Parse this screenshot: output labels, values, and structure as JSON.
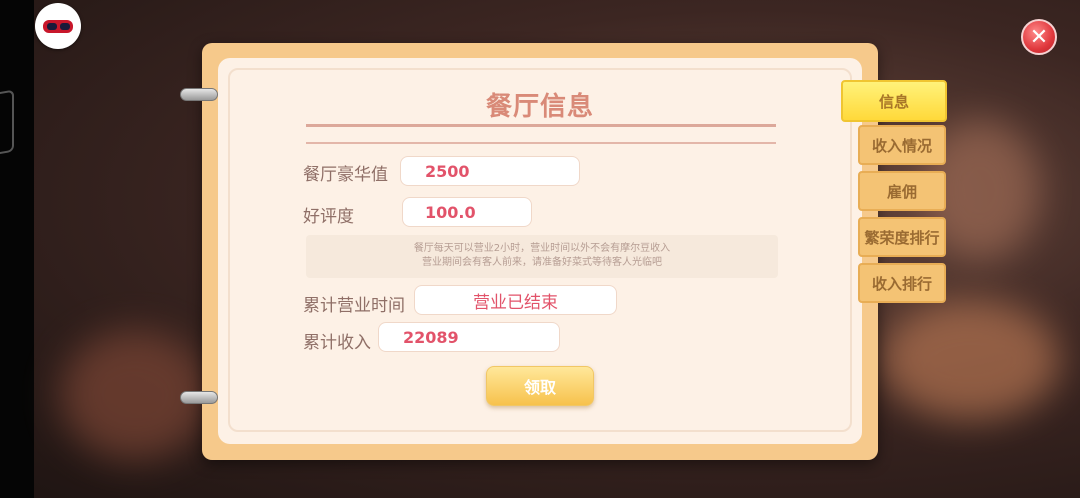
{
  "panel": {
    "title": "餐厅信息",
    "fields": [
      {
        "label": "餐厅豪华值",
        "value": "2500"
      },
      {
        "label": "好评度",
        "value": "100.0"
      }
    ],
    "notice_lines": [
      "餐厅每天可以营业2小时，营业时间以外不会有摩尔豆收入",
      "营业期间会有客人前来，请准备好菜式等待客人光临吧"
    ],
    "business_time": {
      "label": "累计营业时间",
      "value": "营业已结束"
    },
    "total_income": {
      "label": "累计收入",
      "value": "22089"
    },
    "claim_button": "领取"
  },
  "tabs": [
    {
      "label": "信息",
      "active": true
    },
    {
      "label": "收入情况",
      "active": false
    },
    {
      "label": "雇佣",
      "active": false
    },
    {
      "label": "繁荣度排行",
      "active": false
    },
    {
      "label": "收入排行",
      "active": false
    }
  ],
  "close_button": "✕",
  "colors": {
    "accent_text": "#e2536a",
    "tab_active": "#ffd93a",
    "tab_inactive": "#f4c374",
    "book_frame": "#f6c98b"
  }
}
